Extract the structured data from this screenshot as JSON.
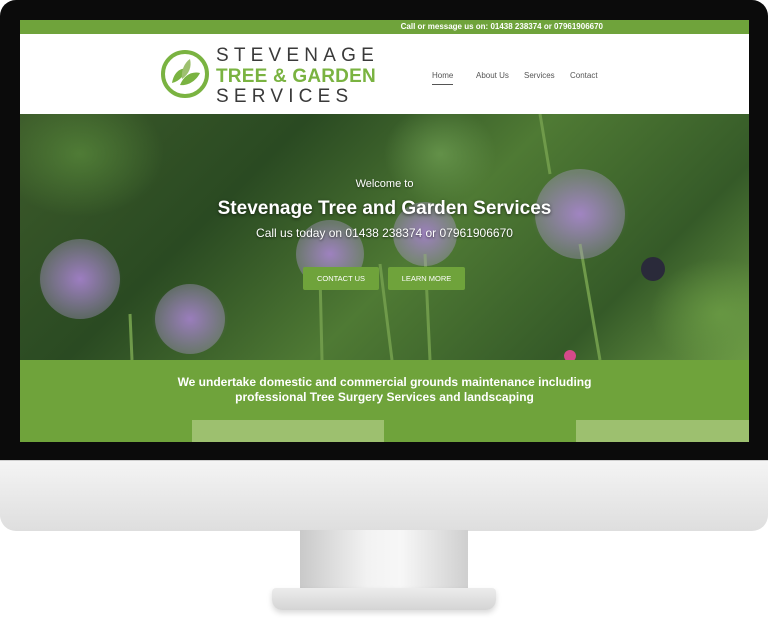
{
  "topbar": {
    "contact_text": "Call or message us on: 01438 238374 or 07961906670"
  },
  "logo": {
    "line1": "STEVENAGE",
    "line2": "TREE & GARDEN",
    "line3": "SERVICES"
  },
  "nav": {
    "items": [
      {
        "label": "Home",
        "active": true
      },
      {
        "label": "About Us",
        "active": false
      },
      {
        "label": "Services",
        "active": false
      },
      {
        "label": "Contact",
        "active": false
      }
    ]
  },
  "hero": {
    "welcome": "Welcome to",
    "title": "Stevenage Tree and Garden Services",
    "subtitle": "Call us today on 01438 238374 or 07961906670",
    "contact_button": "CONTACT US",
    "learn_button": "LEARN MORE"
  },
  "band": {
    "line1": "We undertake domestic and commercial grounds maintenance including",
    "line2": "professional Tree Surgery Services and landscaping"
  },
  "colors": {
    "brand_green": "#6fa33b",
    "light_green": "#9dc06f",
    "logo_green": "#7ab341",
    "dark_text": "#3a3a3a"
  }
}
